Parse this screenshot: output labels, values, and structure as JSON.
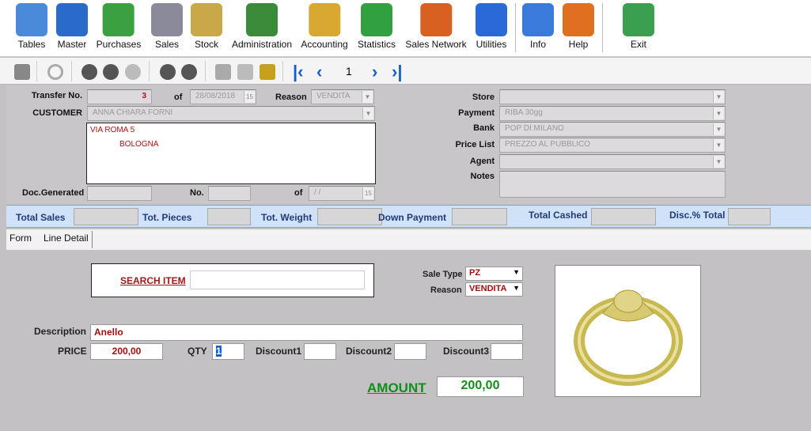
{
  "menu": {
    "items": [
      {
        "label": "Tables",
        "icon": "table-grid-icon",
        "color": "#4a8ad8"
      },
      {
        "label": "Master",
        "icon": "folders-icon",
        "color": "#2a6ac8"
      },
      {
        "label": "Purchases",
        "icon": "money-stack-icon",
        "color": "#3aa040"
      },
      {
        "label": "Sales",
        "icon": "shopping-cart-icon",
        "color": "#8a8a9a"
      },
      {
        "label": "Stock",
        "icon": "warehouse-shelf-icon",
        "color": "#c8a848"
      },
      {
        "label": "Administration",
        "icon": "books-icon",
        "color": "#3a8a3a"
      },
      {
        "label": "Accounting",
        "icon": "money-bag-icon",
        "color": "#d8a830"
      },
      {
        "label": "Statistics",
        "icon": "chart-icon",
        "color": "#30a040"
      },
      {
        "label": "Sales Network",
        "icon": "person-network-icon",
        "color": "#d86020"
      },
      {
        "label": "Utilities",
        "icon": "checklist-icon",
        "color": "#2a6ad8"
      },
      {
        "label": "Info",
        "icon": "info-icon",
        "color": "#3a7ad8"
      },
      {
        "label": "Help",
        "icon": "headset-person-icon",
        "color": "#e07020"
      },
      {
        "label": "Exit",
        "icon": "exit-door-icon",
        "color": "#3aa050"
      }
    ]
  },
  "toolbar": {
    "page": "1"
  },
  "form": {
    "transfer_no_label": "Transfer No.",
    "transfer_no": "3",
    "of_label": "of",
    "date": "28/08/2018",
    "reason_label": "Reason",
    "reason": "VENDITA",
    "customer_label": "CUSTOMER",
    "customer": "ANNA CHIARA FORNI",
    "address_line1": "VIA ROMA 5",
    "address_line2": "BOLOGNA",
    "doc_generated_label": "Doc.Generated",
    "doc_generated": "",
    "no_label": "No.",
    "no": "",
    "of2_label": "of",
    "doc_date": "/ /",
    "store_label": "Store",
    "store": "",
    "payment_label": "Payment",
    "payment": "RIBA 30gg",
    "bank_label": "Bank",
    "bank": "POP DI MILANO",
    "price_list_label": "Price List",
    "price_list": "PREZZO AL PUBBLICO",
    "agent_label": "Agent",
    "agent": "",
    "notes_label": "Notes",
    "notes": ""
  },
  "totals": {
    "total_sales": "Total Sales",
    "tot_pieces": "Tot. Pieces",
    "tot_weight": "Tot. Weight",
    "down_payment": "Down Payment",
    "total_cashed": "Total Cashed",
    "disc_total": "Disc.% Total"
  },
  "tabs": [
    {
      "label": "Form"
    },
    {
      "label": "Line Detail",
      "active": true
    }
  ],
  "detail": {
    "search_label": "SEARCH ITEM",
    "search_value": "",
    "sale_type_label": "Sale Type",
    "sale_type": "PZ",
    "reason_label": "Reason",
    "reason": "VENDITA",
    "description_label": "Description",
    "description": "Anello",
    "price_label": "PRICE",
    "price": "200,00",
    "qty_label": "QTY",
    "qty": "1",
    "discount1_label": "Discount1",
    "discount1": "",
    "discount2_label": "Discount2",
    "discount2": "",
    "discount3_label": "Discount3",
    "discount3": "",
    "amount_label": "AMOUNT",
    "amount": "200,00"
  }
}
